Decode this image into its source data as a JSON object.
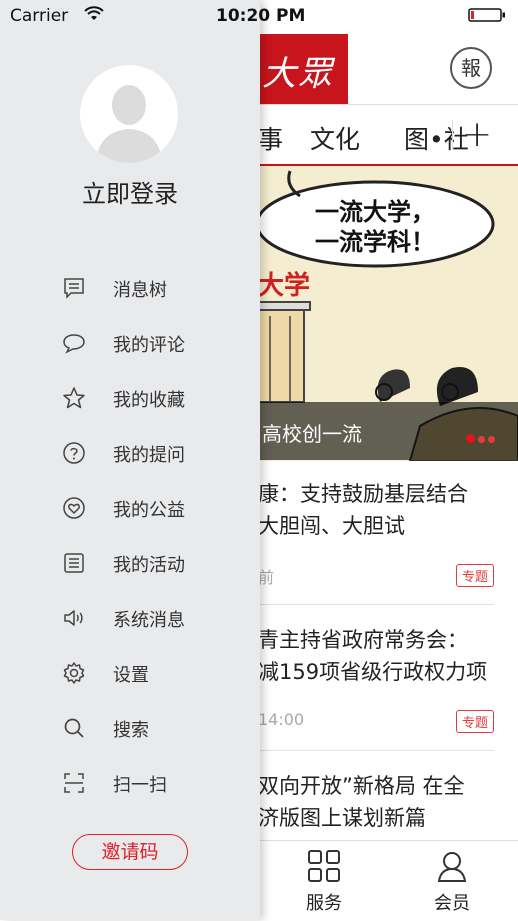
{
  "status_bar": {
    "carrier": "Carrier",
    "time": "10:20 PM"
  },
  "header": {
    "logo_text": "大眾",
    "newspaper_button": "報"
  },
  "channels": {
    "items": [
      "事",
      "文化",
      "图•社"
    ],
    "add_label": "+"
  },
  "banner": {
    "bubble_line1": "一流大学，",
    "bubble_line2": "一流学科！",
    "building_text": "大学",
    "caption": "高校创一流"
  },
  "news": [
    {
      "title_line1": "康：支持鼓励基层结合",
      "title_line2": "大胆闯、大胆试",
      "time": "前",
      "tag": "专题"
    },
    {
      "title_line1": "青主持省政府常务会：",
      "title_line2": "减159项省级行政权力项",
      "time": "14:00",
      "tag": "专题"
    },
    {
      "title_line1": "双向开放”新格局 在全",
      "title_line2": "济版图上谋划新篇",
      "time": "",
      "tag": ""
    }
  ],
  "tabbar": {
    "items": [
      {
        "label": "服务",
        "icon": "grid-icon"
      },
      {
        "label": "会员",
        "icon": "user-icon"
      }
    ]
  },
  "drawer": {
    "login_text": "立即登录",
    "menu": [
      {
        "label": "消息树",
        "icon": "message-list-icon"
      },
      {
        "label": "我的评论",
        "icon": "comment-icon"
      },
      {
        "label": "我的收藏",
        "icon": "star-icon"
      },
      {
        "label": "我的提问",
        "icon": "question-icon"
      },
      {
        "label": "我的公益",
        "icon": "heart-icon"
      },
      {
        "label": "我的活动",
        "icon": "activity-icon"
      },
      {
        "label": "系统消息",
        "icon": "speaker-icon"
      },
      {
        "label": "设置",
        "icon": "gear-icon"
      },
      {
        "label": "搜索",
        "icon": "search-icon"
      },
      {
        "label": "扫一扫",
        "icon": "scan-icon"
      }
    ],
    "invite_button": "邀请码"
  },
  "colors": {
    "accent": "#c8141c",
    "drawer_bg": "#e9eaec",
    "invite": "#e0202a"
  }
}
